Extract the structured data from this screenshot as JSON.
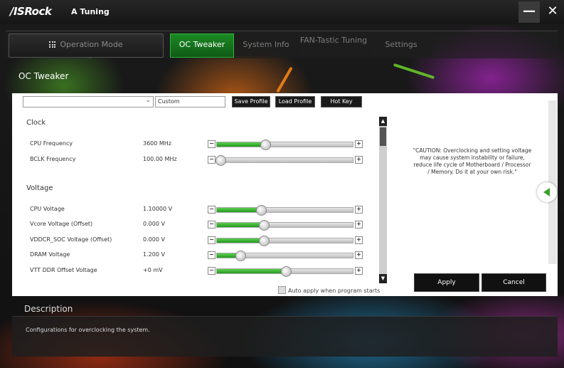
{
  "window": {
    "logo": "/ISRock",
    "app_name": "A Tuning",
    "minimize_label": "—",
    "close_label": "✕"
  },
  "nav": {
    "operation_mode": "Operation Mode",
    "oc_tweaker": "OC Tweaker",
    "system_info": "System Info",
    "fan_tastic": "FAN-Tastic Tuning",
    "settings": "Settings"
  },
  "section_title": "OC Tweaker",
  "profile": {
    "selected": "",
    "name": "Custom",
    "save_label": "Save Profile",
    "load_label": "Load Profile",
    "hotkey_label": "Hot Key"
  },
  "clock": {
    "heading": "Clock",
    "rows": [
      {
        "label": "CPU Frequency",
        "value": "3600 MHz",
        "level": 0.35
      },
      {
        "label": "BCLK Frequency",
        "value": "100.00 MHz",
        "level": 0.02
      }
    ]
  },
  "voltage": {
    "heading": "Voltage",
    "rows": [
      {
        "label": "CPU Voltage",
        "value": "1.10000 V",
        "level": 0.32
      },
      {
        "label": "Vcore Voltage (Offset)",
        "value": "0.000 V",
        "level": 0.34
      },
      {
        "label": "VDDCR_SOC Voltage (Offset)",
        "value": "0.000 V",
        "level": 0.34
      },
      {
        "label": "DRAM Voltage",
        "value": "1.200 V",
        "level": 0.17
      },
      {
        "label": "VTT DDR Offset Voltage",
        "value": "+0 mV",
        "level": 0.5
      }
    ]
  },
  "auto_apply_label": "Auto apply when program starts",
  "caution_text": "\"CAUTION: Overclocking and setting voltage may cause system instability or failure, reduce life cycle of Motherboard / Processor / Memory. Do it at your own risk.\"",
  "apply_label": "Apply",
  "cancel_label": "Cancel",
  "description": {
    "title": "Description",
    "text": "Configurations for overclocking the system."
  },
  "colors": {
    "accent_green": "#2fb23a",
    "slider_fill": "#3cb834"
  }
}
